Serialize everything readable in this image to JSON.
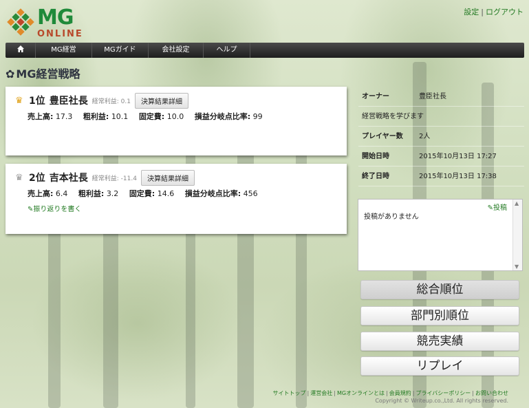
{
  "header": {
    "logo_text": "MG",
    "logo_subtext": "ONLINE",
    "links": {
      "settings": "設定",
      "logout": "ログアウト"
    }
  },
  "nav": {
    "home_icon": "home-icon",
    "items": [
      "MG経営",
      "MGガイド",
      "会社設定",
      "ヘルプ"
    ]
  },
  "page_title": "MG経営戦略",
  "rankings": [
    {
      "rank": "1位",
      "name": "豊臣社長",
      "profit_label": "経常利益:",
      "profit_value": "0.1",
      "detail_button": "決算結果詳細",
      "sales_label": "売上高:",
      "sales": "17.3",
      "gross_label": "粗利益:",
      "gross": "10.1",
      "fixed_label": "固定費:",
      "fixed": "10.0",
      "bep_label": "損益分岐点比率:",
      "bep": "99",
      "crown": "gold"
    },
    {
      "rank": "2位",
      "name": "吉本社長",
      "profit_label": "経常利益:",
      "profit_value": "-11.4",
      "detail_button": "決算結果詳細",
      "sales_label": "売上高:",
      "sales": "6.4",
      "gross_label": "粗利益:",
      "gross": "3.2",
      "fixed_label": "固定費:",
      "fixed": "14.6",
      "bep_label": "損益分岐点比率:",
      "bep": "456",
      "reflect_link": "振り返りを書く",
      "crown": "silver"
    }
  ],
  "info": {
    "owner_label": "オーナー",
    "owner": "豊臣社長",
    "description": "経営戦略を学びます",
    "players_label": "プレイヤー数",
    "players": "2人",
    "start_label": "開始日時",
    "start": "2015年10月13日 17:27",
    "end_label": "終了日時",
    "end": "2015年10月13日 17:38"
  },
  "posts": {
    "post_link": "投稿",
    "empty": "投稿がありません"
  },
  "buttons": {
    "overall": "総合順位",
    "department": "部門別順位",
    "auction": "競売実績",
    "replay": "リプレイ"
  },
  "footer": {
    "links": [
      "サイトトップ",
      "運営会社",
      "MGオンラインとは",
      "会員規約",
      "プライバシーポリシー",
      "お問い合わせ"
    ],
    "copyright": "Copyright © Writeup.co.,Ltd. All rights reserved."
  }
}
